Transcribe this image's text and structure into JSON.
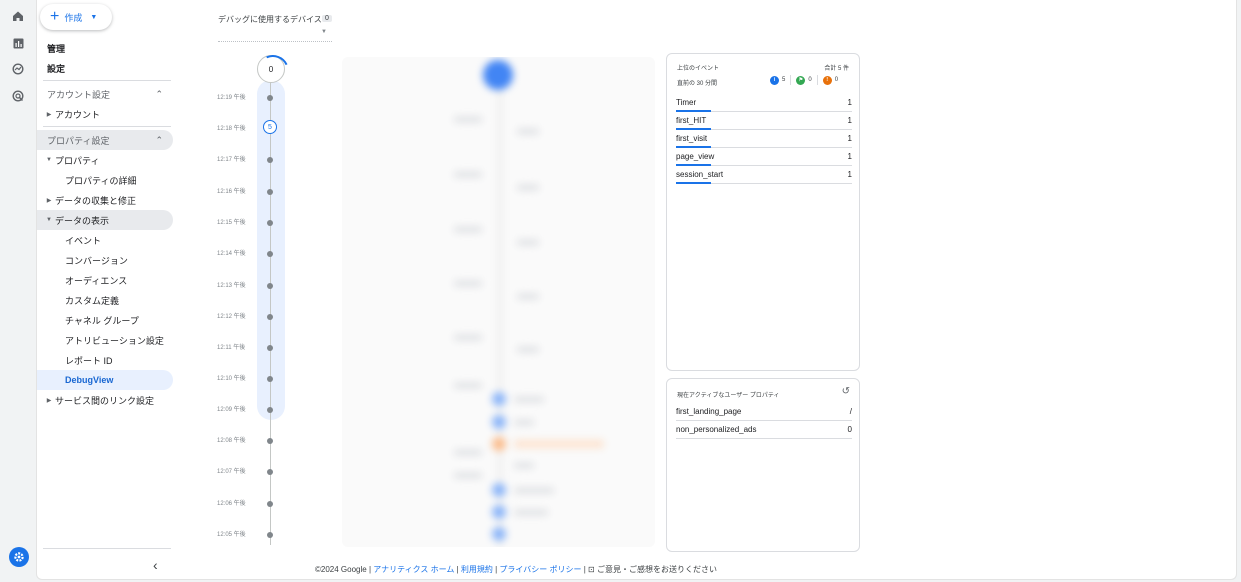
{
  "rail": {
    "icons": [
      "home-icon",
      "reports-icon",
      "explore-icon",
      "advertising-icon"
    ]
  },
  "create_button": {
    "label": "作成"
  },
  "nav": {
    "admin": "管理",
    "settings": "設定",
    "account_section": "アカウント設定",
    "account": "アカウント",
    "property_section": "プロパティ設定",
    "property": "プロパティ",
    "property_details": "プロパティの詳細",
    "data_collection": "データの収集と修正",
    "data_display": "データの表示",
    "events": "イベント",
    "conversions": "コンバージョン",
    "audiences": "オーディエンス",
    "custom_definitions": "カスタム定義",
    "channel_groups": "チャネル グループ",
    "attribution_settings": "アトリビューション設定",
    "report_id": "レポート ID",
    "debugview": "DebugView",
    "product_links": "サービス間のリンク設定"
  },
  "device": {
    "label": "デバッグに使用するデバイス",
    "count": "0"
  },
  "timeline": {
    "top_count": "0",
    "rows": [
      {
        "time": "12:19 午後"
      },
      {
        "time": "12:18 午後",
        "count": "5"
      },
      {
        "time": "12:17 午後"
      },
      {
        "time": "12:16 午後"
      },
      {
        "time": "12:15 午後"
      },
      {
        "time": "12:14 午後"
      },
      {
        "time": "12:13 午後"
      },
      {
        "time": "12:12 午後"
      },
      {
        "time": "12:11 午後"
      },
      {
        "time": "12:10 午後"
      },
      {
        "time": "12:09 午後"
      },
      {
        "time": "12:08 午後"
      },
      {
        "time": "12:07 午後"
      },
      {
        "time": "12:06 午後"
      },
      {
        "time": "12:05 午後"
      }
    ]
  },
  "top_events": {
    "title": "上位のイベント",
    "total": "合計 5 件",
    "subtitle": "直前の 30 分間",
    "counts": {
      "blue": "5",
      "green": "0",
      "orange": "0"
    },
    "colors": {
      "blue": "#1a73e8",
      "green": "#34a853",
      "orange": "#e8710a"
    },
    "rows": [
      {
        "name": "Timer",
        "value": "1"
      },
      {
        "name": "first_HIT",
        "value": "1"
      },
      {
        "name": "first_visit",
        "value": "1"
      },
      {
        "name": "page_view",
        "value": "1"
      },
      {
        "name": "session_start",
        "value": "1"
      }
    ]
  },
  "user_properties": {
    "title": "現在アクティブなユーザー プロパティ",
    "rows": [
      {
        "name": "first_landing_page",
        "value": "/"
      },
      {
        "name": "non_personalized_ads",
        "value": "0"
      }
    ]
  },
  "footer": {
    "copyright": "©2024 Google",
    "analytics_home": "アナリティクス ホーム",
    "terms": "利用規約",
    "privacy": "プライバシー ポリシー",
    "feedback": "ご意見・ご感想をお送りください"
  }
}
